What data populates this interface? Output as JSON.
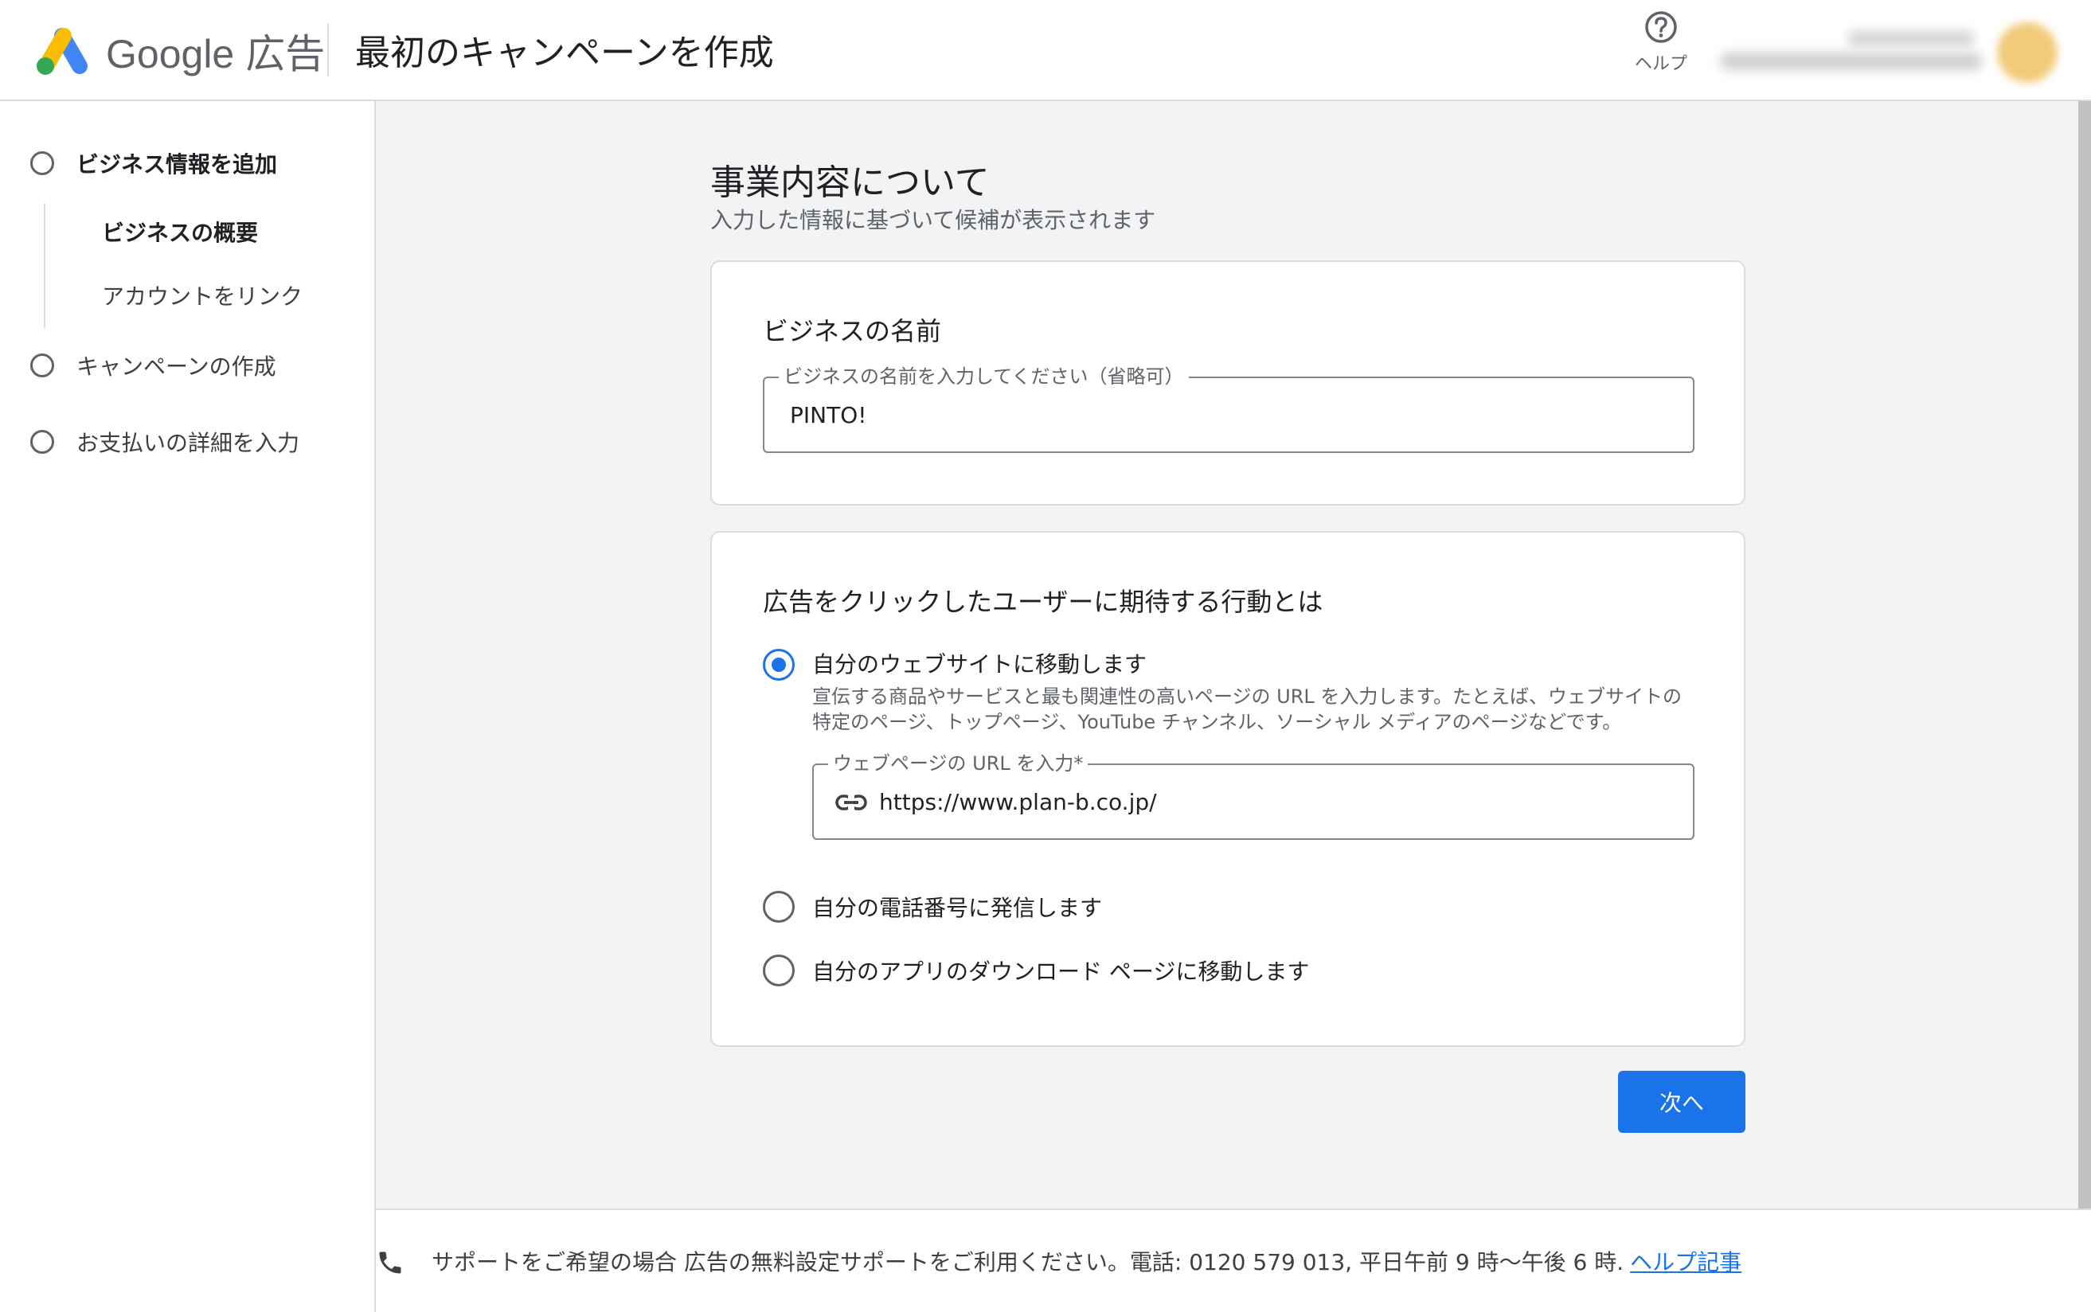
{
  "header": {
    "brand_name": "Google",
    "brand_suffix": "広告",
    "title": "最初のキャンペーンを作成",
    "help_label": "ヘルプ",
    "help_icon": "help-circle-icon",
    "logo_colors": [
      "#fbbc04",
      "#4285f4",
      "#34a853"
    ]
  },
  "sidebar": {
    "steps": [
      {
        "label": "ビジネス情報を追加",
        "active": true
      },
      {
        "label": "キャンペーンの作成",
        "active": false
      },
      {
        "label": "お支払いの詳細を入力",
        "active": false
      }
    ],
    "substeps": [
      {
        "label": "ビジネスの概要",
        "active": true
      },
      {
        "label": "アカウントをリンク",
        "active": false
      }
    ]
  },
  "main": {
    "title": "事業内容について",
    "subtitle": "入力した情報に基づいて候補が表示されます",
    "business_card": {
      "heading": "ビジネスの名前",
      "field_label": "ビジネスの名前を入力してください（省略可）",
      "field_value": "PINTO!"
    },
    "goal_card": {
      "heading": "広告をクリックしたユーザーに期待する行動とは",
      "options": [
        {
          "label": "自分のウェブサイトに移動します",
          "selected": true,
          "description": "宣伝する商品やサービスと最も関連性の高いページの URL を入力します。たとえば、ウェブサイトの特定のページ、トップページ、YouTube チャンネル、ソーシャル メディアのページなどです。"
        },
        {
          "label": "自分の電話番号に発信します",
          "selected": false
        },
        {
          "label": "自分のアプリのダウンロード ページに移動します",
          "selected": false
        }
      ],
      "url_field_label": "ウェブページの URL を入力*",
      "url_field_value": "https://www.plan-b.co.jp/",
      "url_icon": "link-icon"
    },
    "next_button": "次へ",
    "accent_color": "#1a73e8"
  },
  "footer": {
    "text": "サポートをご希望の場合 広告の無料設定サポートをご利用ください。電話: 0120 579 013, 平日午前 9 時～午後 6 時.",
    "link_text": "ヘルプ記事",
    "phone_icon": "phone-icon"
  }
}
